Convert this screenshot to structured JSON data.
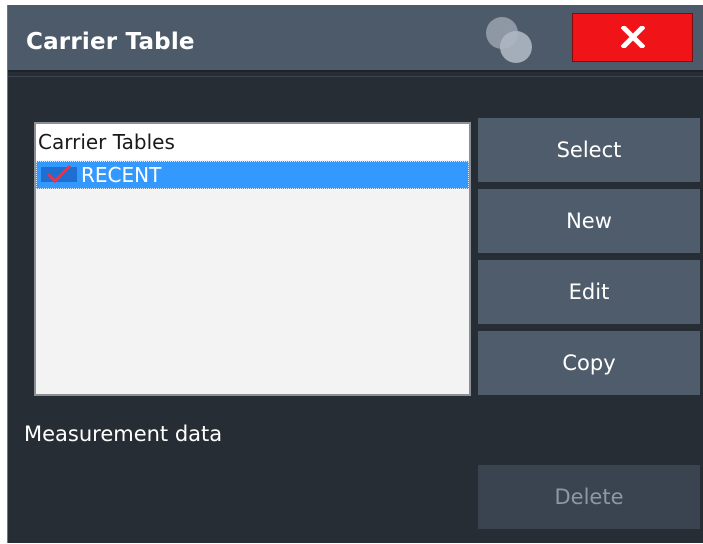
{
  "dialog": {
    "title": "Carrier Table",
    "close_label": "X"
  },
  "list": {
    "header": "Carrier Tables",
    "rows": [
      {
        "label": "RECENT",
        "checked": true
      }
    ]
  },
  "buttons": {
    "select": "Select",
    "new": "New",
    "edit": "Edit",
    "copy": "Copy",
    "delete": "Delete"
  },
  "section": {
    "measurement_label": "Measurement data"
  },
  "icons": {
    "overlap": "overlap-circles-icon",
    "close": "close-icon",
    "check": "checkmark-icon"
  },
  "colors": {
    "title_bar": "#4d5a69",
    "background": "#272d35",
    "close": "#f01418",
    "selection": "#3399ff",
    "button": "#4f5c6b"
  }
}
